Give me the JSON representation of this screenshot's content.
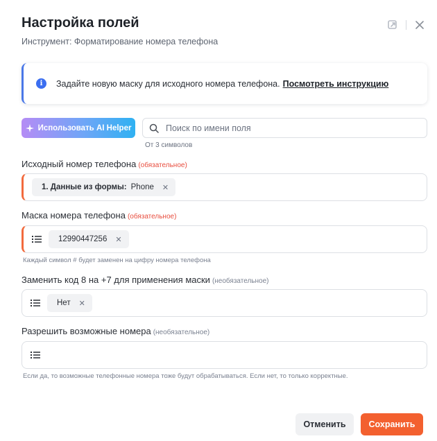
{
  "header": {
    "title": "Настройка полей",
    "subtitle": "Инструмент: Форматирование номера телефона",
    "icons": [
      "refresh-icon",
      "close-icon"
    ]
  },
  "info": {
    "text": "Задайте новую маску для исходного номера телефона.",
    "link": "Посмотреть инструкцию",
    "icon": "info-icon"
  },
  "toolbar": {
    "ai_button_label": "Использовать AI Helper",
    "search_placeholder": "Поиск по имени поля",
    "search_value": "",
    "search_hint": "От 3 символов"
  },
  "fields": [
    {
      "label": "Исходный номер телефона",
      "tag": "(обязательное)",
      "chip_prefix": "1. Данные из формы:",
      "chip_value": "Phone"
    },
    {
      "label": "Маска номера телефона",
      "tag": "(обязательное)",
      "chip_value": "12990447256",
      "hint": "Каждый символ # будет заменен на цифру номера телефона"
    },
    {
      "label": "Заменить код 8 на +7 для применения маски",
      "tag": "(необязательное)",
      "chip_value": "Нет"
    },
    {
      "label": "Разрешить возможные номера",
      "tag": "(необязательное)",
      "hint": "Если да, то возможные телефонные номера тоже будут обрабатываться. Если нет, то только корректные."
    }
  ],
  "footer": {
    "cancel_label": "Отменить",
    "save_label": "Сохранить"
  },
  "colors": {
    "accent": "#f3602f",
    "info": "#3b6ef0",
    "required": "#e84c3d"
  }
}
